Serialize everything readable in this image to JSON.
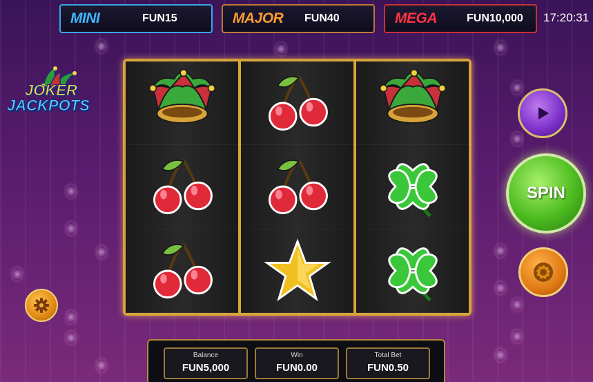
{
  "jackpots": {
    "mini": {
      "name": "MINI",
      "value": "FUN15"
    },
    "major": {
      "name": "MAJOR",
      "value": "FUN40"
    },
    "mega": {
      "name": "MEGA",
      "value": "FUN10,000"
    }
  },
  "clock": "17:20:31",
  "logo": {
    "line1": "JOKER",
    "line2": "JACKPOTS"
  },
  "reels": [
    [
      "jester-hat",
      "cherries",
      "cherries"
    ],
    [
      "cherries",
      "cherries",
      "star"
    ],
    [
      "jester-hat",
      "clover",
      "clover"
    ]
  ],
  "buttons": {
    "spin_label": "SPIN",
    "play_icon": "play-icon",
    "coin_icon": "coin-icon",
    "settings_icon": "gear-icon"
  },
  "footer": {
    "balance": {
      "label": "Balance",
      "value": "FUN5,000"
    },
    "win": {
      "label": "Win",
      "value": "FUN0.00"
    },
    "total_bet": {
      "label": "Total Bet",
      "value": "FUN0.50"
    }
  },
  "colors": {
    "mini": "#3fb6ff",
    "major": "#ff9a33",
    "mega": "#ff3344",
    "frame": "#d8a43a",
    "spin": "#4cbc20"
  }
}
